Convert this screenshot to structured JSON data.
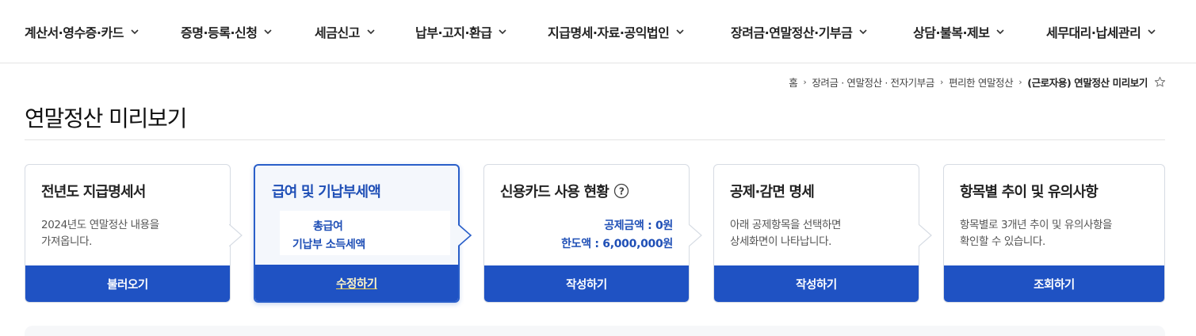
{
  "nav": {
    "items": [
      {
        "label": "계산서·영수증·카드"
      },
      {
        "label": "증명·등록·신청"
      },
      {
        "label": "세금신고"
      },
      {
        "label": "납부·고지·환급"
      },
      {
        "label": "지급명세·자료·공익법인"
      },
      {
        "label": "장려금·연말정산·기부금"
      },
      {
        "label": "상담·불복·제보"
      },
      {
        "label": "세무대리·납세관리"
      }
    ]
  },
  "breadcrumb": {
    "items": [
      "홈",
      "장려금 · 연말정산 · 전자기부금",
      "편리한 연말정산",
      "(근로자용) 연말정산 미리보기"
    ]
  },
  "page": {
    "title": "연말정산 미리보기"
  },
  "cards": [
    {
      "title": "전년도 지급명세서",
      "desc1": "2024년도 연말정산 내용을",
      "desc2": "가져옵니다.",
      "button": "불러오기"
    },
    {
      "title": "급여 및 기납부세액",
      "line1": "총급여",
      "line2": "기납부 소득세액",
      "button": "수정하기"
    },
    {
      "title": "신용카드 사용 현황",
      "line1": "공제금액 : 0원",
      "line2": "한도액 : 6,000,000원",
      "button": "작성하기"
    },
    {
      "title": "공제·감면 명세",
      "desc1": "아래 공제항목을 선택하면",
      "desc2": "상세화면이 나타납니다.",
      "button": "작성하기"
    },
    {
      "title": "항목별 추이 및 유의사항",
      "desc1": "항목별로 3개년 추이 및 유의사항을",
      "desc2": "확인할 수 있습니다.",
      "button": "조회하기"
    }
  ],
  "colors": {
    "accent": "#1f52c3",
    "accent_text": "#1f4fb6",
    "active_border": "#2a5fc9",
    "highlight": "#f5d242"
  },
  "icons": {
    "nav_chevron": "chevron-down-icon",
    "breadcrumb_separator": "chevron-right-icon",
    "favorite": "star-icon",
    "help": "question-circle-icon",
    "step_arrow": "chevron-right-icon"
  }
}
